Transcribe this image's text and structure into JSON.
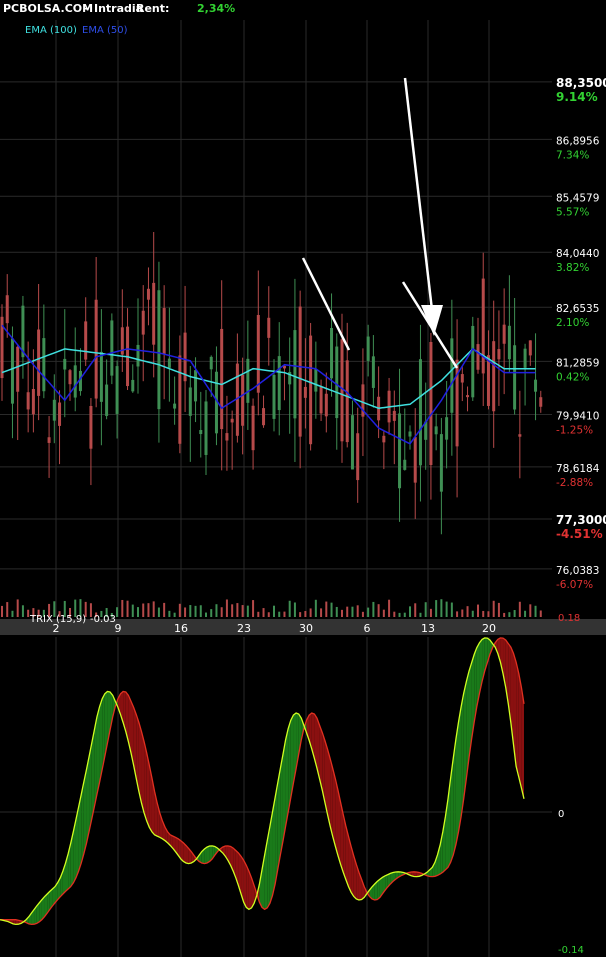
{
  "header": {
    "site": "PCBOLSA.COM",
    "sep": "-",
    "mode": "Intradia",
    "rent_label": "Rent:",
    "rent_value": "2,34%"
  },
  "legend": {
    "ema100": "EMA (100)",
    "ema50": "EMA (50)"
  },
  "colors": {
    "background": "#000000",
    "grid": "#2a2a2a",
    "candle_up": "#3f8f54",
    "candle_down": "#b64a4a",
    "ema100": "#3fe0e0",
    "ema50": "#2020e0",
    "trix_line": "#d0ff20",
    "trix_signal": "#e03020",
    "trix_fill_up": "#1a7a1a",
    "trix_fill_down": "#8a1010",
    "pct_up": "#32d232",
    "pct_down": "#e03232",
    "arrow": "#ffffff"
  },
  "price_axis": [
    {
      "price": "88,3500",
      "pct": "9.14%",
      "dir": "up",
      "bold": true
    },
    {
      "price": "86,8956",
      "pct": "7.34%",
      "dir": "up",
      "bold": false
    },
    {
      "price": "85,4579",
      "pct": "5.57%",
      "dir": "up",
      "bold": false
    },
    {
      "price": "84,0440",
      "pct": "3.82%",
      "dir": "up",
      "bold": false
    },
    {
      "price": "82,6535",
      "pct": "2.10%",
      "dir": "up",
      "bold": false
    },
    {
      "price": "81,2859",
      "pct": "0.42%",
      "dir": "up",
      "bold": false
    },
    {
      "price": "79,9410",
      "pct": "-1.25%",
      "dir": "down",
      "bold": false
    },
    {
      "price": "78,6184",
      "pct": "-2.88%",
      "dir": "down",
      "bold": false
    },
    {
      "price": "77,3000",
      "pct": "-4.51%",
      "dir": "down",
      "bold": true
    },
    {
      "price": "76,0383",
      "pct": "-6.07%",
      "dir": "down",
      "bold": false
    }
  ],
  "x_ticks": [
    "2",
    "9",
    "16",
    "23",
    "30",
    "6",
    "13",
    "20"
  ],
  "trix": {
    "label": "TRIX (15,9)",
    "value": "-0.03",
    "axis": [
      "0.18",
      "0",
      "-0.14"
    ]
  },
  "chart_data": [
    {
      "type": "line",
      "series": [
        {
          "name": "EMA (100)",
          "x": [
            0,
            6,
            12,
            18,
            24,
            30,
            36,
            42,
            48,
            54,
            60,
            66,
            72,
            78,
            84,
            90,
            96,
            102
          ],
          "values": [
            81.0,
            81.3,
            81.6,
            81.5,
            81.4,
            81.2,
            80.9,
            80.7,
            81.1,
            81.0,
            80.7,
            80.4,
            80.1,
            80.2,
            80.8,
            81.6,
            81.1,
            81.1
          ]
        },
        {
          "name": "EMA (50)",
          "x": [
            0,
            6,
            12,
            18,
            24,
            30,
            36,
            42,
            48,
            54,
            60,
            66,
            72,
            78,
            84,
            90,
            96,
            102
          ],
          "values": [
            82.2,
            81.2,
            80.3,
            81.4,
            81.6,
            81.5,
            81.3,
            80.1,
            80.6,
            81.2,
            81.1,
            80.5,
            79.6,
            79.2,
            80.3,
            81.6,
            81.0,
            81.0
          ]
        }
      ],
      "ylim": [
        75.8,
        88.6
      ],
      "x_ticks": [
        "2",
        "9",
        "16",
        "23",
        "30",
        "6",
        "13",
        "20"
      ],
      "price_ticks": [
        88.35,
        86.8956,
        85.4579,
        84.044,
        82.6535,
        81.2859,
        79.941,
        78.6184,
        77.3,
        76.0383
      ]
    },
    {
      "type": "line",
      "series": [
        {
          "name": "TRIX (15,9)",
          "x": [
            0,
            4,
            8,
            12,
            16,
            20,
            24,
            28,
            32,
            36,
            40,
            44,
            48,
            52,
            56,
            60,
            64,
            68,
            72,
            76,
            80,
            84,
            88,
            92,
            96,
            100
          ],
          "values": [
            -0.11,
            -0.12,
            -0.09,
            -0.07,
            0.03,
            0.14,
            0.09,
            -0.02,
            -0.03,
            -0.06,
            -0.03,
            -0.05,
            -0.12,
            0.0,
            0.12,
            0.06,
            -0.04,
            -0.1,
            -0.07,
            -0.06,
            -0.07,
            -0.05,
            0.12,
            0.19,
            0.16,
            -0.02
          ]
        }
      ],
      "ylim": [
        -0.14,
        0.18
      ]
    }
  ]
}
